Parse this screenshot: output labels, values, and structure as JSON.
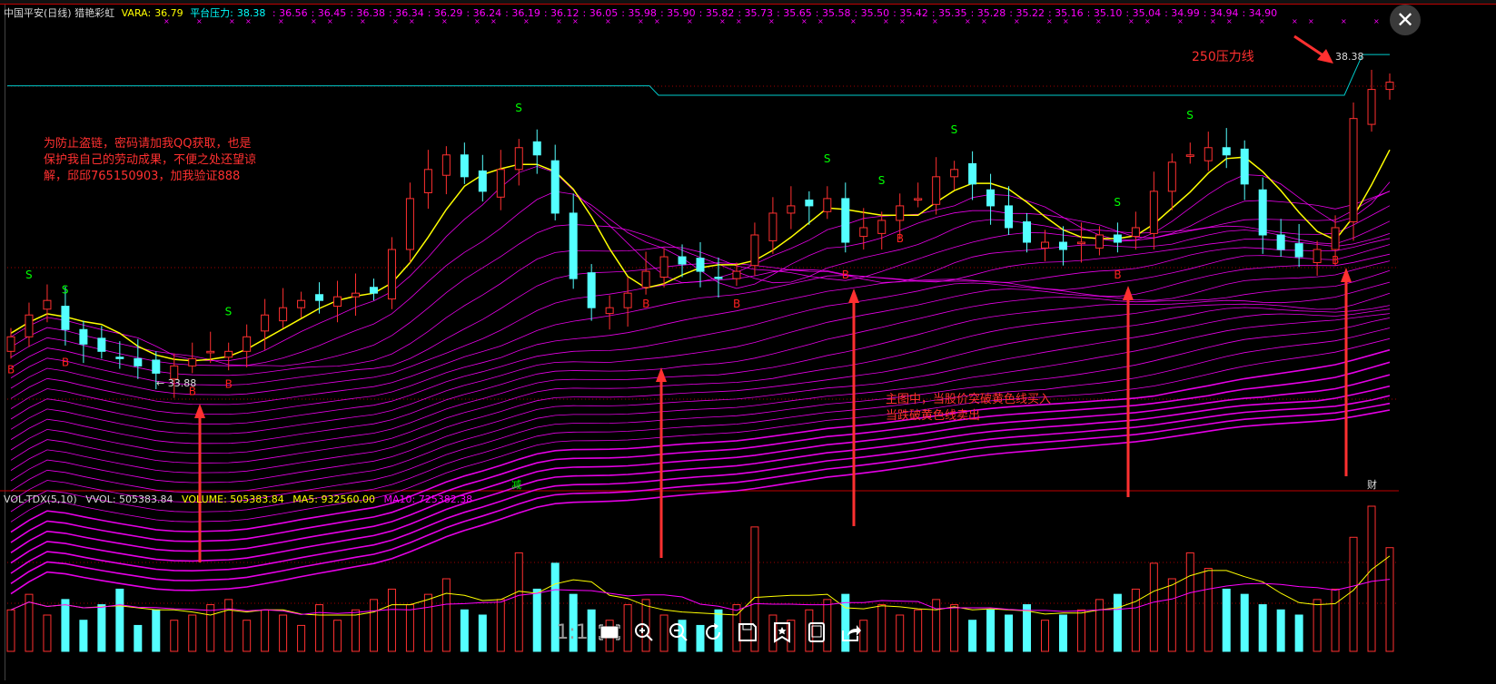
{
  "header": {
    "title": "中国平安(日线) 猎艳彩虹",
    "vara_label": "VARA:",
    "vara_value": "36.79",
    "pressure_label": "平台压力:",
    "pressure_value": "38.38",
    "pressure_levels": [
      "36.56",
      "36.45",
      "36.38",
      "36.34",
      "36.29",
      "36.24",
      "36.19",
      "36.12",
      "36.05",
      "35.98",
      "35.90",
      "35.82",
      "35.73",
      "35.65",
      "35.58",
      "35.50",
      "35.42",
      "35.35",
      "35.28",
      "35.22",
      "35.16",
      "35.10",
      "35.04",
      "34.99",
      "34.94",
      "34.90"
    ]
  },
  "annotations": {
    "note_lines": [
      "为防止盗链，密码请加我QQ获取，也是",
      "保护我自己的劳动成果，不便之处还望谅",
      "解，邱邱765150903，加我验证888"
    ],
    "pressure_line_label": "250压力线",
    "rule_lines": [
      "主图中，当股价突破黄色线买入",
      "当跌破黄色线卖出"
    ],
    "high_label": "38.38",
    "low_label": "33.88",
    "marker_jian": "减",
    "marker_cai": "财",
    "buy_signal": "B",
    "sell_signal": "S"
  },
  "volume_header": {
    "indicator": "VOL-TDX(5,10)",
    "vvol": "VVOL: 505383.84",
    "volume": "VOLUME: 505383.84",
    "ma5": "MA5: 932560.00",
    "ma10": "MA10: 725382.38"
  },
  "viewer": {
    "ratio_label": "1:1",
    "tools": [
      "fit-screen",
      "zoom-in",
      "zoom-out",
      "rotate",
      "save",
      "bookmark",
      "tablet",
      "share"
    ]
  },
  "colors": {
    "up": "#ff3030",
    "down": "#54ffff",
    "ma": "#ffff00",
    "rainbow": "#ff00ff",
    "pressure": "#00cccc",
    "arrow": "#ff3030"
  },
  "chart_data": {
    "type": "candlestick",
    "price_range": [
      33.88,
      38.38
    ],
    "pressure_line": {
      "before": 37.95,
      "after": 37.82,
      "last": 38.38
    },
    "closes": [
      34.5,
      34.8,
      35.0,
      34.6,
      34.4,
      34.3,
      34.2,
      34.1,
      34.0,
      34.1,
      34.2,
      34.3,
      34.3,
      34.5,
      34.8,
      34.9,
      35.0,
      35.0,
      35.05,
      35.1,
      35.1,
      35.7,
      36.4,
      36.8,
      37.0,
      36.7,
      36.5,
      36.8,
      37.1,
      37.0,
      36.2,
      35.3,
      34.9,
      34.9,
      35.1,
      35.4,
      35.6,
      35.5,
      35.4,
      35.3,
      35.4,
      35.9,
      36.2,
      36.3,
      36.3,
      36.4,
      35.8,
      36.0,
      36.1,
      36.3,
      36.4,
      36.7,
      36.8,
      36.6,
      36.3,
      36.0,
      35.8,
      35.8,
      35.7,
      35.8,
      35.9,
      35.8,
      36.0,
      36.5,
      36.9,
      37.0,
      37.1,
      37.0,
      36.6,
      35.9,
      35.7,
      35.6,
      35.7,
      36.0,
      37.5,
      37.9,
      38.0
    ],
    "volumes": [
      40,
      55,
      35,
      50,
      30,
      45,
      60,
      25,
      40,
      30,
      35,
      45,
      50,
      30,
      40,
      35,
      25,
      45,
      30,
      40,
      50,
      60,
      45,
      55,
      70,
      40,
      35,
      50,
      95,
      60,
      85,
      55,
      40,
      30,
      45,
      50,
      35,
      30,
      25,
      40,
      45,
      120,
      35,
      30,
      40,
      50,
      55,
      30,
      45,
      35,
      40,
      50,
      45,
      30,
      40,
      35,
      45,
      30,
      35,
      40,
      50,
      55,
      60,
      85,
      70,
      95,
      80,
      60,
      55,
      45,
      40,
      35,
      50,
      60,
      110,
      140,
      100
    ],
    "buy_indices": [
      0,
      3,
      10,
      12,
      35,
      40,
      46,
      49,
      61,
      73
    ],
    "sell_indices": [
      1,
      3,
      12,
      28,
      45,
      48,
      52,
      61,
      65
    ]
  }
}
